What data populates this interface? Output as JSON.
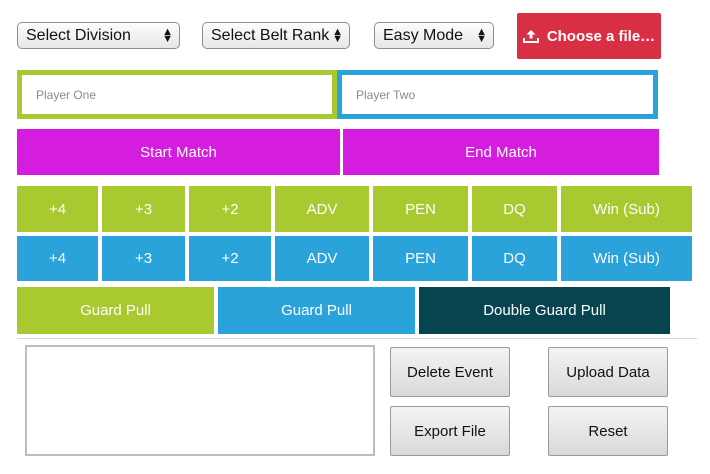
{
  "selects": {
    "division": "Select Division",
    "belt_rank": "Select Belt Rank",
    "mode": "Easy Mode"
  },
  "file_button": {
    "label": "Choose a file…",
    "icon": "upload-icon"
  },
  "players": {
    "one_placeholder": "Player One",
    "two_placeholder": "Player Two"
  },
  "match": {
    "start_label": "Start Match",
    "end_label": "End Match"
  },
  "player_one_scores": [
    "+4",
    "+3",
    "+2",
    "ADV",
    "PEN",
    "DQ",
    "Win (Sub)"
  ],
  "player_two_scores": [
    "+4",
    "+3",
    "+2",
    "ADV",
    "PEN",
    "DQ",
    "Win (Sub)"
  ],
  "guard_pull": {
    "player_one": "Guard Pull",
    "player_two": "Guard Pull",
    "double": "Double Guard Pull"
  },
  "actions": {
    "delete_event": "Delete Event",
    "upload_data": "Upload Data",
    "export_file": "Export File",
    "reset": "Reset"
  },
  "colors": {
    "player_one": "#a9c930",
    "player_two": "#29a3d9",
    "match_controls": "#d41ddf",
    "double_guard_pull": "#064450",
    "file_button": "#d92f45"
  }
}
